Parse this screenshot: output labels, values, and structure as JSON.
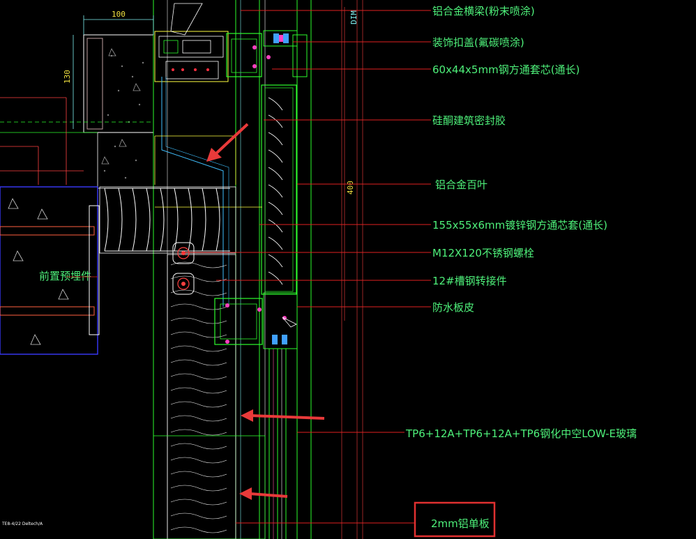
{
  "dimensions": {
    "top_width": "100",
    "left_height": "130",
    "panel_height": "400",
    "dim_label": "DIM"
  },
  "callouts": [
    {
      "id": "aluminum-beam",
      "text": "铝合金横梁(粉末喷涂)"
    },
    {
      "id": "decorative-cover",
      "text": "装饰扣盖(氟碳喷涂)"
    },
    {
      "id": "steel-sleeve-60",
      "text": "60x44x5mm钢方通套芯(通长)"
    },
    {
      "id": "silicone-sealant",
      "text": "硅酮建筑密封胶"
    },
    {
      "id": "aluminum-louver",
      "text": "铝合金百叶"
    },
    {
      "id": "steel-tube-155",
      "text": "155x55x6mm镀锌钢方通芯套(通长)"
    },
    {
      "id": "m12-bolt",
      "text": "M12X120不锈钢螺栓"
    },
    {
      "id": "channel-connector",
      "text": "12#槽钢转接件"
    },
    {
      "id": "waterproof-membrane",
      "text": "防水板皮"
    },
    {
      "id": "low-e-glass",
      "text": "TP6+12A+TP6+12A+TP6钢化中空LOW-E玻璃"
    },
    {
      "id": "aluminum-panel",
      "text": "2mm铝单板"
    }
  ],
  "embedded_part_label": "前置预埋件",
  "tiny_note": "TE8-4/22 Deltech/A",
  "colors": {
    "background": "#000000",
    "label": "#4ef07a",
    "leader": "#e02020",
    "highlight_box": "#e03030",
    "arrow": "#e83a3a",
    "frame": "#2dfc2d",
    "insulation": "#ffffff",
    "dimension": "#f0e040",
    "slab": "#3a3aff"
  }
}
